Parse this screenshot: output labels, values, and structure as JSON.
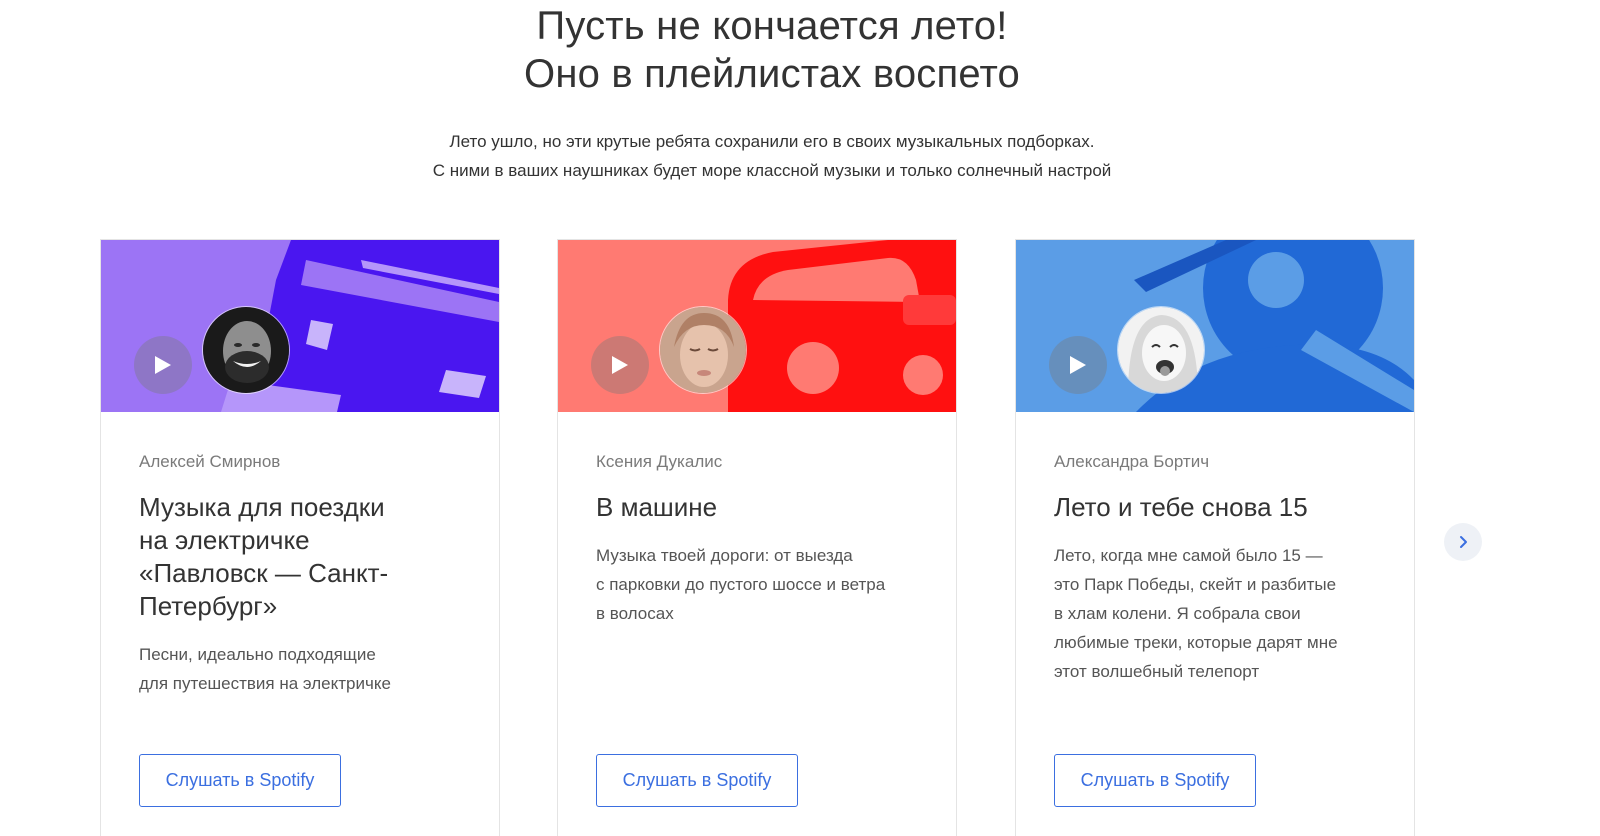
{
  "header": {
    "title_line1": "Пусть не кончается лето!",
    "title_line2": "Оно в плейлистах воспето",
    "subtitle_line1": "Лето ушло, но эти крутые ребята сохранили его в своих музыкальных подборках.",
    "subtitle_line2": "С ними в ваших наушниках будет море классной музыки и только солнечный настрой"
  },
  "cards": [
    {
      "author": "Алексей Смирнов",
      "title_lines": [
        "Музыка для поездки",
        "на электричке",
        "«Павловск — Санкт-",
        "Петербург»"
      ],
      "desc_lines": [
        "Песни, идеально подходящие",
        "для путешествия на электричке"
      ],
      "button_label": "Слушать в Spotify",
      "banner_color": "#9c74f5",
      "shape_color": "#4a16f0",
      "play_icon": "play-icon",
      "avatar_icon": "man-portrait"
    },
    {
      "author": "Ксения Дукалис",
      "title_lines": [
        "В машине"
      ],
      "desc_lines": [
        "Музыка твоей дороги: от выезда",
        "с парковки до пустого шоссе и ветра",
        "в волосах"
      ],
      "button_label": "Слушать в Spotify",
      "banner_color": "#ff7a72",
      "shape_color": "#ff1010",
      "play_icon": "play-icon",
      "avatar_icon": "woman-portrait"
    },
    {
      "author": "Александра Бортич",
      "title_lines": [
        "Лето и тебе снова 15"
      ],
      "desc_lines": [
        "Лето, когда мне самой было 15 —",
        "это Парк Победы, скейт и разбитые",
        "в хлам колени. Я собрала свои",
        "любимые треки, которые дарят мне",
        "этот волшебный телепорт"
      ],
      "button_label": "Слушать в Spotify",
      "banner_color": "#5b9de6",
      "shape_color": "#2169d6",
      "play_icon": "play-icon",
      "avatar_icon": "woman-portrait"
    }
  ],
  "carousel": {
    "next_icon": "chevron-right-icon"
  },
  "colors": {
    "accent": "#3b6fe0",
    "text": "#333333",
    "muted": "#7a7a7a"
  }
}
